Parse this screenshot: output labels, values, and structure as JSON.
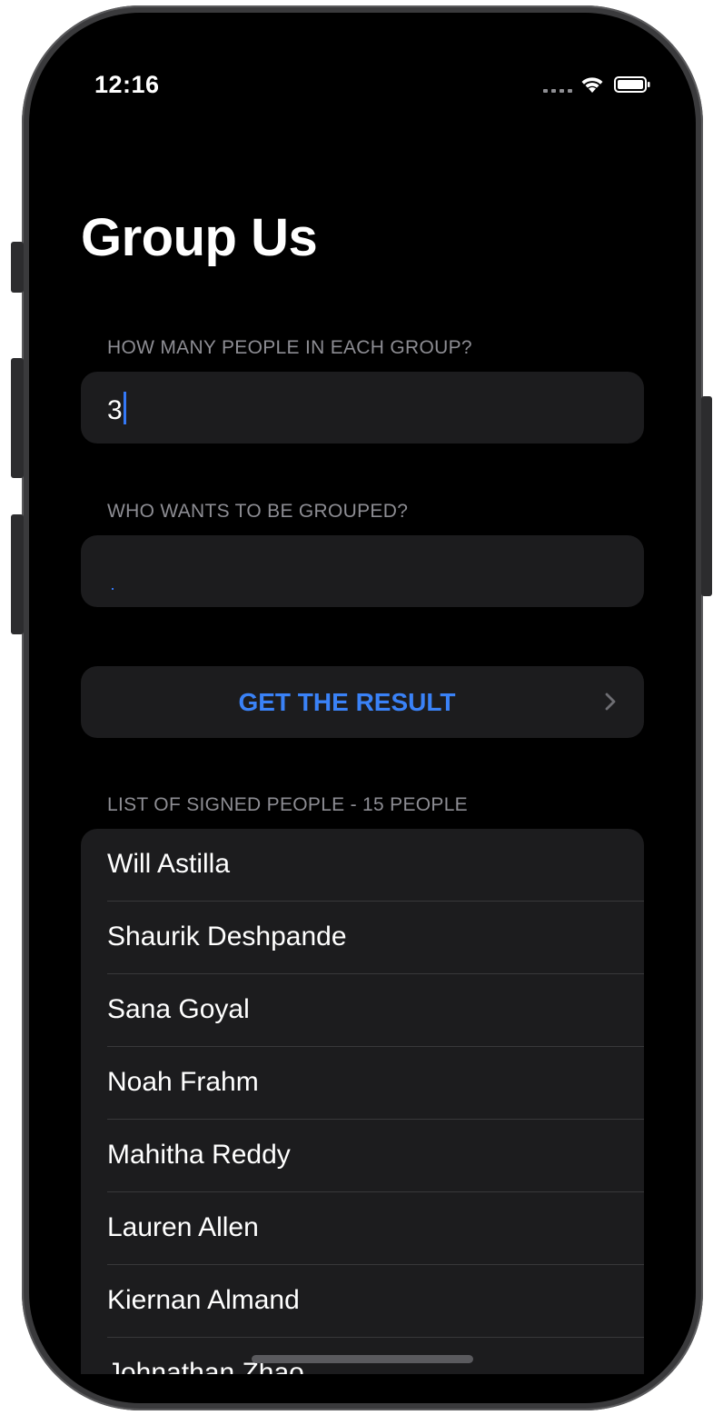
{
  "status_bar": {
    "time": "12:16",
    "icons": [
      "cellular-dots-icon",
      "wifi-icon",
      "battery-icon"
    ]
  },
  "title": "Group Us",
  "group_size_section": {
    "header": "HOW MANY PEOPLE IN EACH GROUP?",
    "value": "3"
  },
  "participants_section": {
    "header": "WHO WANTS TO BE GROUPED?",
    "value": ""
  },
  "result_button": {
    "label": "GET THE RESULT",
    "icon": "chevron-right-icon"
  },
  "people_list": {
    "header": "LIST OF SIGNED PEOPLE - 15 PEOPLE",
    "items": [
      "Will Astilla",
      "Shaurik Deshpande",
      "Sana Goyal",
      "Noah Frahm",
      "Mahitha Reddy",
      "Lauren Allen",
      "Kiernan Almand",
      "Johnathan Zhao"
    ]
  },
  "colors": {
    "background": "#000000",
    "cell": "#1c1c1e",
    "accent": "#3a82f7",
    "secondary_text": "#8d8d93"
  }
}
